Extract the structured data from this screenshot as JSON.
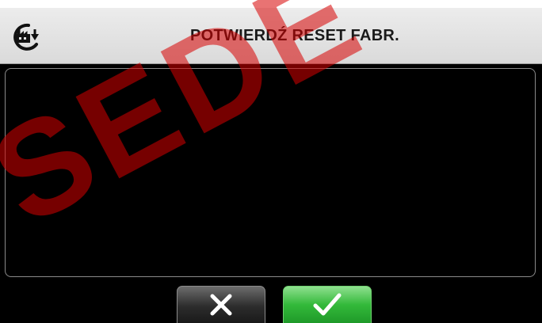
{
  "header": {
    "title": "POTWIERDŹ RESET FABR.",
    "icon": "factory-reset-icon"
  },
  "buttons": {
    "cancel": {
      "icon": "close-icon",
      "color": "#2c2c2c"
    },
    "confirm": {
      "icon": "checkmark-icon",
      "color": "#33b93a"
    }
  },
  "watermark": {
    "text": "SEDE"
  }
}
